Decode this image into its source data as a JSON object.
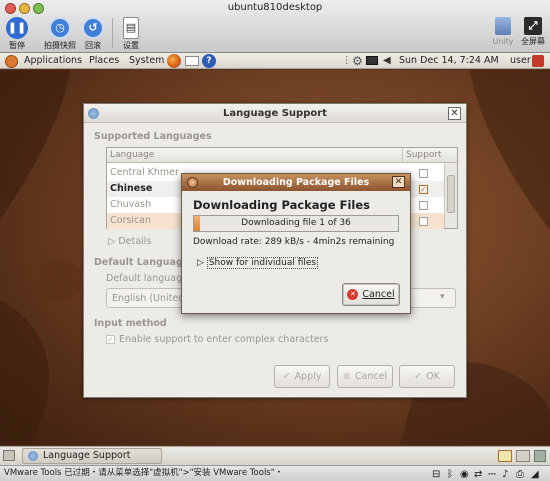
{
  "vmware": {
    "title": "ubuntu810desktop",
    "toolbar": [
      {
        "label": "暂停",
        "icon": "pause-icon"
      },
      {
        "label": "拍摄快照",
        "icon": "snapshot-icon"
      },
      {
        "label": "回滚",
        "icon": "revert-icon"
      },
      {
        "label": "设置",
        "icon": "settings-icon"
      }
    ],
    "unity_label": "Unity",
    "fullscreen_label": "全屏幕",
    "status_text": "VMware Tools 已过期・请从菜单选择\"虚拟机\">\"安装 VMware Tools\"・"
  },
  "panel": {
    "menus": [
      "Applications",
      "Places",
      "System"
    ],
    "clock": "Sun Dec 14,  7:24 AM",
    "user": "user"
  },
  "language_window": {
    "title": "Language Support",
    "supported_heading": "Supported Languages",
    "col_language": "Language",
    "col_support": "Support",
    "rows": [
      {
        "name": "Central Khmer",
        "checked": false
      },
      {
        "name": "Chinese",
        "checked": true
      },
      {
        "name": "Chuvash",
        "checked": false
      },
      {
        "name": "Corsican",
        "checked": false
      }
    ],
    "details_label": "Details",
    "default_heading": "Default Language",
    "default_label": "Default language",
    "default_value": "English (United States)",
    "input_heading": "Input method",
    "input_checkbox_label": "Enable support to enter complex characters",
    "apply_label": "Apply",
    "cancel_label": "Cancel",
    "ok_label": "OK"
  },
  "download_dialog": {
    "title": "Downloading Package Files",
    "heading": "Downloading Package Files",
    "progress_text": "Downloading file 1 of 36",
    "progress_fraction": 0.028,
    "rate_text": "Download rate: 289 kB/s - 4min2s remaining",
    "expander_label": "Show for individual files",
    "cancel_label": "Cancel"
  },
  "taskbar": {
    "task_label": "Language Support"
  }
}
